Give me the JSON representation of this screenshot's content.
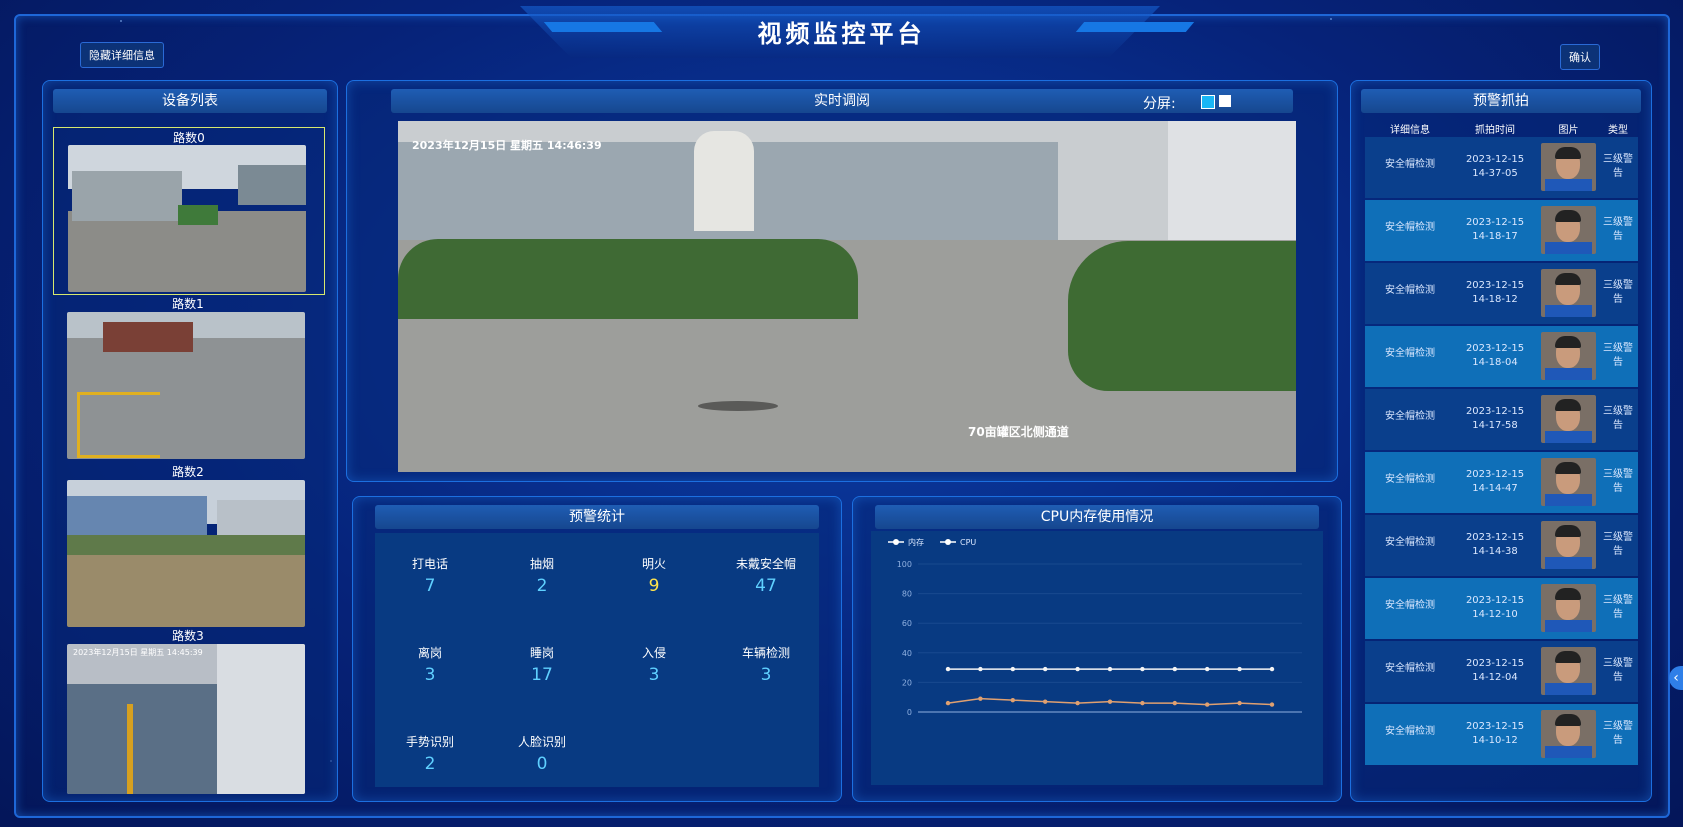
{
  "header": {
    "title": "视频监控平台",
    "hide_details_label": "隐藏详细信息",
    "confirm_label": "确认"
  },
  "device_list": {
    "title": "设备列表",
    "items": [
      {
        "label": "路数0",
        "overlay": ""
      },
      {
        "label": "路数1",
        "overlay": ""
      },
      {
        "label": "路数2",
        "overlay": ""
      },
      {
        "label": "路数3",
        "overlay": "2023年12月15日 星期五 14:45:39"
      }
    ]
  },
  "live_view": {
    "title": "实时调阅",
    "split_label": "分屏:",
    "timestamp_overlay": "2023年12月15日 星期五 14:46:39",
    "location_overlay": "70亩罐区北侧通道"
  },
  "alarm_stats": {
    "title": "预警统计",
    "items": [
      {
        "label": "打电话",
        "value": "7"
      },
      {
        "label": "抽烟",
        "value": "2"
      },
      {
        "label": "明火",
        "value": "9"
      },
      {
        "label": "未戴安全帽",
        "value": "47"
      },
      {
        "label": "离岗",
        "value": "3"
      },
      {
        "label": "睡岗",
        "value": "17"
      },
      {
        "label": "入侵",
        "value": "3"
      },
      {
        "label": "车辆检测",
        "value": "3"
      },
      {
        "label": "手势识别",
        "value": "2"
      },
      {
        "label": "人脸识别",
        "value": "0"
      }
    ]
  },
  "cpu_panel": {
    "title": "CPU内存使用情况"
  },
  "chart_data": {
    "type": "line",
    "title": "",
    "xlabel": "",
    "ylabel": "",
    "ylim": [
      0,
      100
    ],
    "yticks": [
      "0",
      "20",
      "40",
      "60",
      "80",
      "100"
    ],
    "legend_position": "top-left",
    "series": [
      {
        "name": "内存",
        "color": "#f4f4f4",
        "values": [
          29,
          29,
          29,
          29,
          29,
          29,
          29,
          29,
          29,
          29,
          29
        ]
      },
      {
        "name": "CPU",
        "color": "#e0a070",
        "values": [
          6,
          9,
          8,
          7,
          6,
          7,
          6,
          6,
          5,
          6,
          5
        ]
      }
    ]
  },
  "snapshots": {
    "title": "预警抓拍",
    "headers": [
      "详细信息",
      "抓拍时间",
      "图片",
      "类型"
    ],
    "rows": [
      {
        "info": "安全帽检测",
        "date": "2023-12-15",
        "time": "14-37-05",
        "type": "三级警告"
      },
      {
        "info": "安全帽检测",
        "date": "2023-12-15",
        "time": "14-18-17",
        "type": "三级警告"
      },
      {
        "info": "安全帽检测",
        "date": "2023-12-15",
        "time": "14-18-12",
        "type": "三级警告"
      },
      {
        "info": "安全帽检测",
        "date": "2023-12-15",
        "time": "14-18-04",
        "type": "三级警告"
      },
      {
        "info": "安全帽检测",
        "date": "2023-12-15",
        "time": "14-17-58",
        "type": "三级警告"
      },
      {
        "info": "安全帽检测",
        "date": "2023-12-15",
        "time": "14-14-47",
        "type": "三级警告"
      },
      {
        "info": "安全帽检测",
        "date": "2023-12-15",
        "time": "14-14-38",
        "type": "三级警告"
      },
      {
        "info": "安全帽检测",
        "date": "2023-12-15",
        "time": "14-12-10",
        "type": "三级警告"
      },
      {
        "info": "安全帽检测",
        "date": "2023-12-15",
        "time": "14-12-04",
        "type": "三级警告"
      },
      {
        "info": "安全帽检测",
        "date": "2023-12-15",
        "time": "14-10-12",
        "type": "三级警告"
      }
    ]
  },
  "colors": {
    "accent": "#1aa0ff",
    "row_light": "#0f6fb8",
    "row_dark": "#0a3f8c",
    "yellow_value": "#ffe34d"
  }
}
